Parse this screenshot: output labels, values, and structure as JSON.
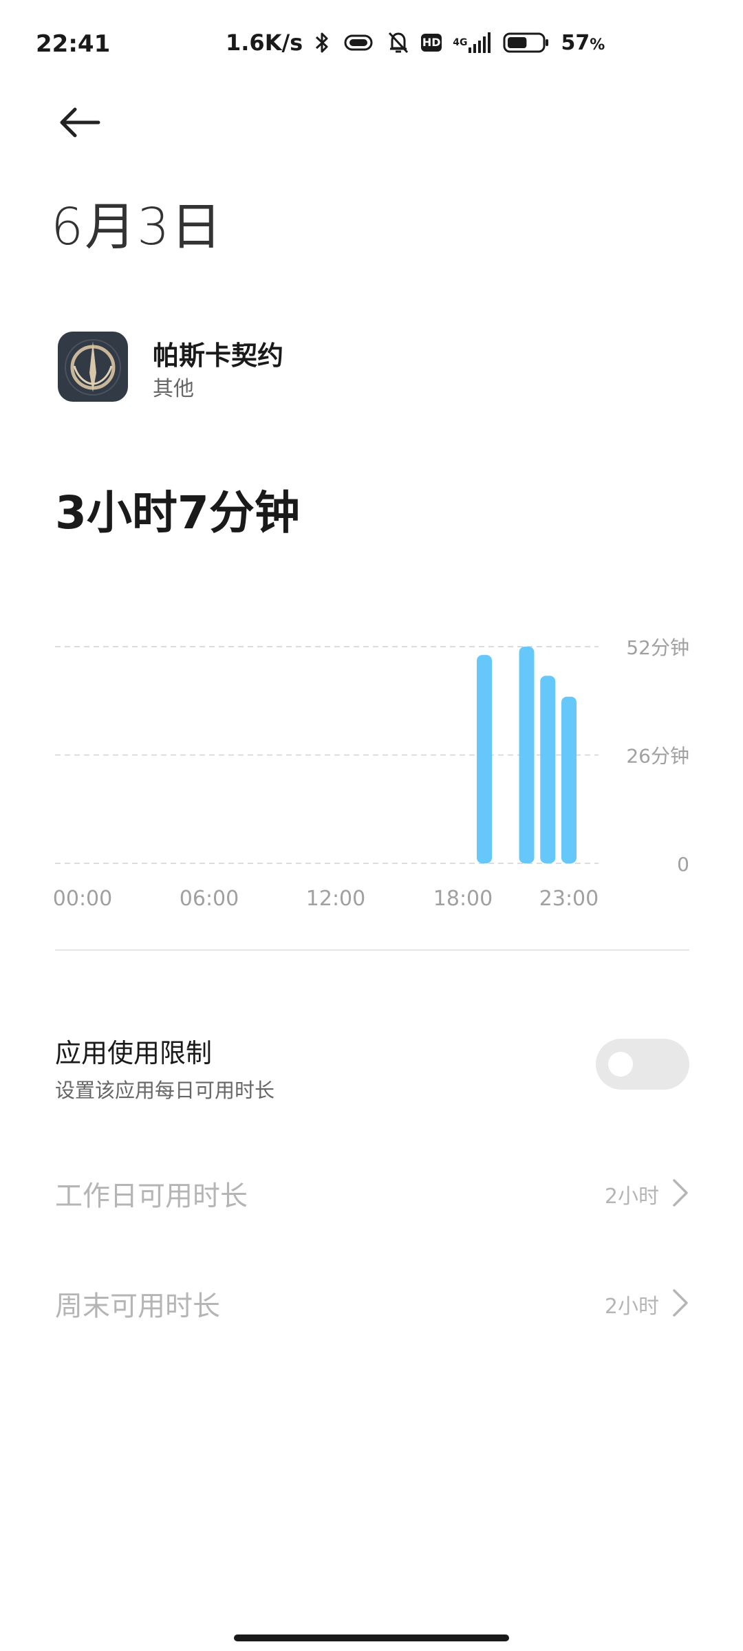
{
  "status_bar": {
    "time": "22:41",
    "net_speed": "1.6K/s",
    "hd_label": "HD",
    "network_type": "4G",
    "battery_percent": "57",
    "percent_sign": "%",
    "battery_level": 57,
    "icons": [
      "bluetooth-icon",
      "vibrate-icon",
      "mute-bell-icon",
      "hd-icon",
      "signal-icon",
      "battery-icon"
    ]
  },
  "header": {
    "back_icon": "arrow-left-icon",
    "title": "6月3日"
  },
  "app": {
    "name": "帕斯卡契约",
    "category": "其他",
    "icon": "pascal-contract-app-icon"
  },
  "usage": {
    "total": "3小时7分钟"
  },
  "chart_data": {
    "type": "bar",
    "title": "",
    "xlabel": "",
    "ylabel": "",
    "x_tick_labels": [
      "00:00",
      "06:00",
      "12:00",
      "18:00",
      "23:00"
    ],
    "y_tick_labels": [
      "52分钟",
      "26分钟",
      "0"
    ],
    "y_ticks": [
      52,
      26,
      0
    ],
    "ylim": [
      0,
      52
    ],
    "x_range_hours": [
      0,
      24
    ],
    "categories": [
      "19:00",
      "21:00",
      "22:00",
      "23:00"
    ],
    "category_hours": [
      19,
      21,
      22,
      23
    ],
    "values": [
      50,
      52,
      45,
      40
    ],
    "grid": true,
    "color": "#66c8fa"
  },
  "limit": {
    "title": "应用使用限制",
    "subtitle": "设置该应用每日可用时长",
    "enabled": false
  },
  "settings": [
    {
      "label": "工作日可用时长",
      "value": "2小时"
    },
    {
      "label": "周末可用时长",
      "value": "2小时"
    }
  ],
  "colors": {
    "bar": "#66c8fa",
    "disabled_text": "#b5b5b5",
    "secondary_text": "#666666",
    "toggle_off": "#e8e8e8"
  }
}
